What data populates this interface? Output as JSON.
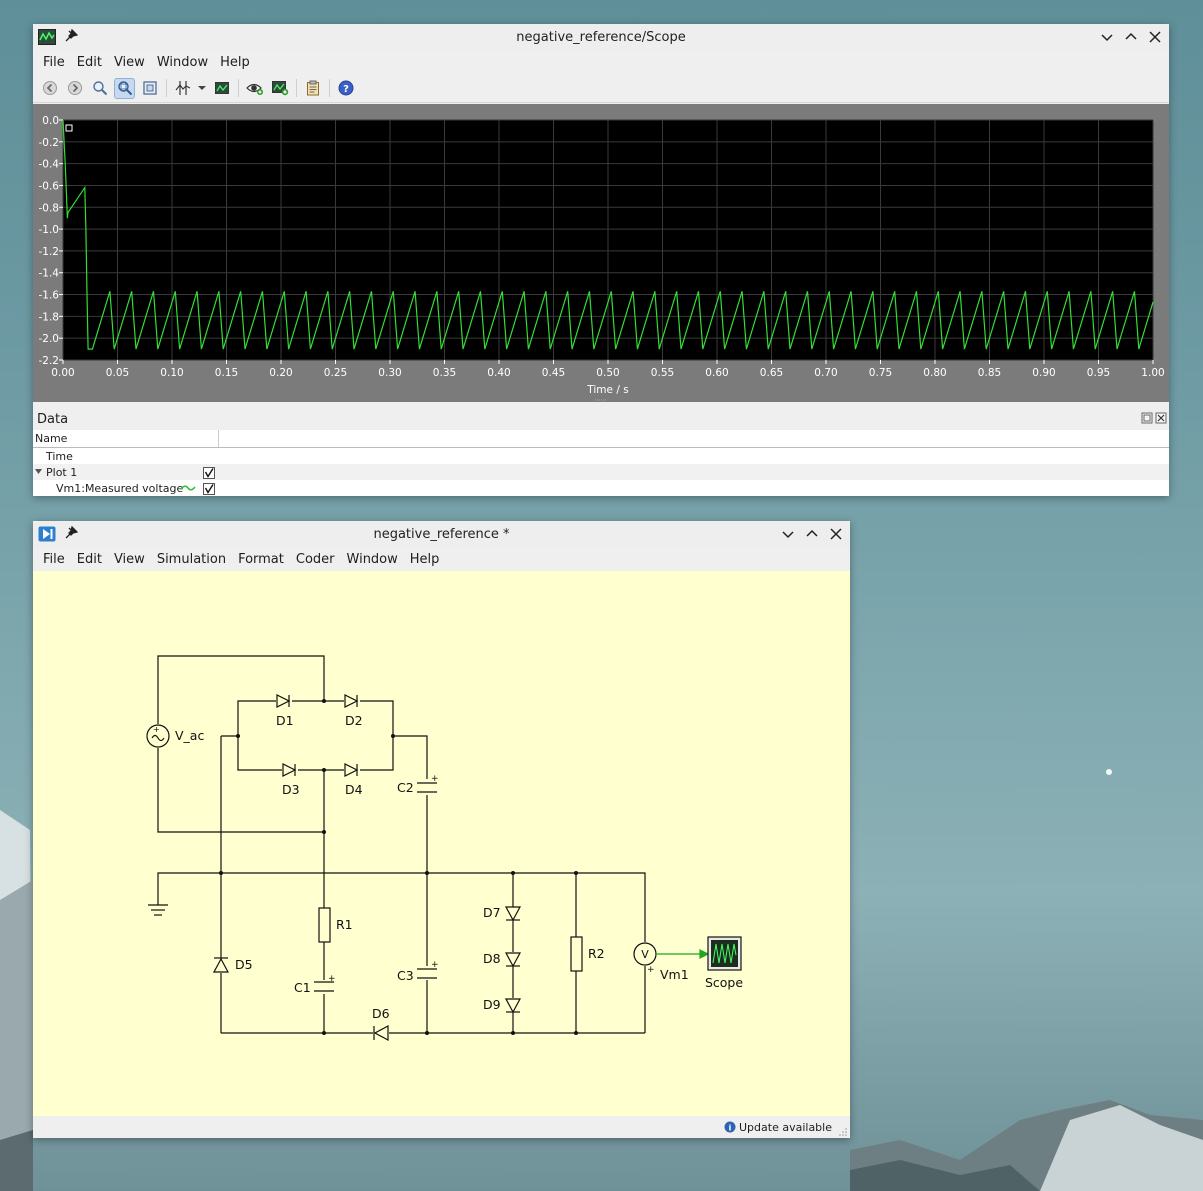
{
  "scope_window": {
    "title": "negative_reference/Scope",
    "menu": [
      "File",
      "Edit",
      "View",
      "Window",
      "Help"
    ],
    "toolbar_icons": [
      "back-icon",
      "forward-icon",
      "zoom-icon",
      "zoom-box-icon",
      "zoom-fit-icon",
      "cursor-icon",
      "dropdown-icon",
      "screenshot-icon",
      "eye-icon",
      "add-plot-icon",
      "clipboard-icon",
      "help-icon"
    ]
  },
  "chart_data": {
    "type": "line",
    "xlabel": "Time / s",
    "ylabel": "",
    "xlim": [
      0.0,
      1.0
    ],
    "ylim": [
      -2.2,
      0.0
    ],
    "x_ticks": [
      "0.00",
      "0.05",
      "0.10",
      "0.15",
      "0.20",
      "0.25",
      "0.30",
      "0.35",
      "0.40",
      "0.45",
      "0.50",
      "0.55",
      "0.60",
      "0.65",
      "0.70",
      "0.75",
      "0.80",
      "0.85",
      "0.90",
      "0.95",
      "1.00"
    ],
    "y_ticks": [
      "0.0",
      "-0.2",
      "-0.4",
      "-0.6",
      "-0.8",
      "-1.0",
      "-1.2",
      "-1.4",
      "-1.6",
      "-1.8",
      "-2.0",
      "-2.2"
    ],
    "grid": true,
    "series": [
      {
        "name": "Vm1:Measured voltage",
        "color": "#33dd33",
        "x": [
          0.0,
          0.002,
          0.004,
          0.0045,
          0.02,
          0.021,
          0.022,
          0.023,
          0.027,
          0.043,
          0.047
        ],
        "y": [
          0.0,
          -0.4,
          -0.9,
          -0.85,
          -0.62,
          -1.0,
          -1.6,
          -2.1,
          -2.1,
          -1.57,
          -2.1
        ],
        "sawtooth": {
          "start": 0.027,
          "end": 1.0,
          "period": 0.02,
          "low": -2.1,
          "high": -1.57
        }
      }
    ]
  },
  "data_panel": {
    "title": "Data",
    "column_name": "Name",
    "rows": [
      {
        "label": "Time",
        "checked": null
      },
      {
        "label": "Plot 1",
        "checked": true
      },
      {
        "label": "Vm1:Measured voltage",
        "checked": true
      }
    ]
  },
  "schematic_window": {
    "title": "negative_reference *",
    "menu": [
      "File",
      "Edit",
      "View",
      "Simulation",
      "Format",
      "Coder",
      "Window",
      "Help"
    ],
    "status": "Update available",
    "components": {
      "source": "V_ac",
      "diodes": [
        "D1",
        "D2",
        "D3",
        "D4",
        "D5",
        "D6",
        "D7",
        "D8",
        "D9"
      ],
      "capacitors": [
        "C1",
        "C2",
        "C3"
      ],
      "resistors": [
        "R1",
        "R2"
      ],
      "meter": "Vm1",
      "meter_symbol": "V",
      "scope": "Scope"
    }
  }
}
